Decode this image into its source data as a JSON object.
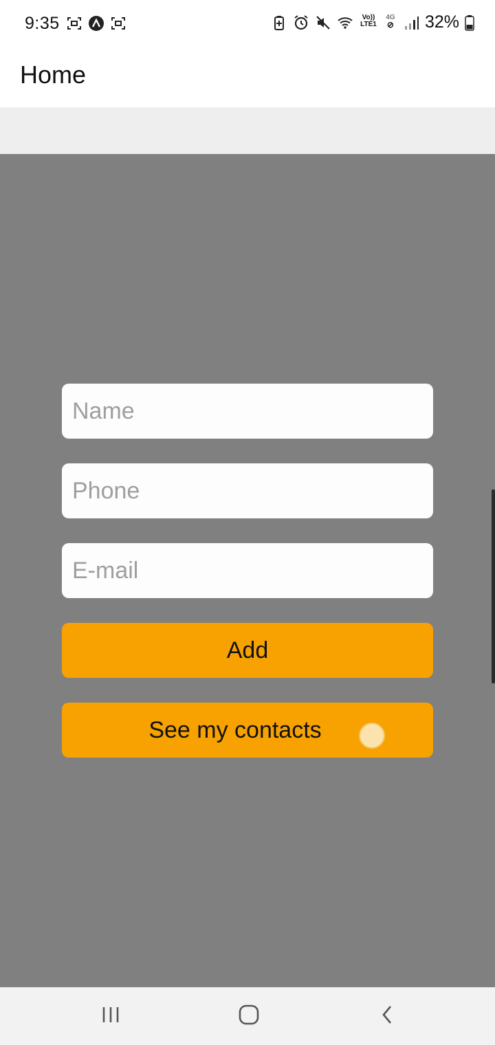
{
  "status_bar": {
    "time": "9:35",
    "left_icons": [
      "screenshot-icon",
      "app-a-icon",
      "screenshot-icon"
    ],
    "right_icons": [
      "battery-saver-icon",
      "alarm-icon",
      "mute-icon",
      "wifi-icon",
      "volte-icon",
      "4g-icon",
      "signal-icon"
    ],
    "volte_label_top": "Vo))",
    "volte_label_bottom": "LTE1",
    "network_label": "4G",
    "battery_percent": "32%"
  },
  "app_bar": {
    "title": "Home"
  },
  "form": {
    "name_placeholder": "Name",
    "phone_placeholder": "Phone",
    "email_placeholder": "E-mail",
    "add_label": "Add",
    "contacts_label": "See my contacts"
  },
  "nav_bar": {
    "buttons": [
      "recents-icon",
      "home-icon",
      "back-icon"
    ]
  },
  "colors": {
    "overlay": "#808080",
    "button": "#f7a200",
    "input_bg": "#fdfdfd"
  }
}
